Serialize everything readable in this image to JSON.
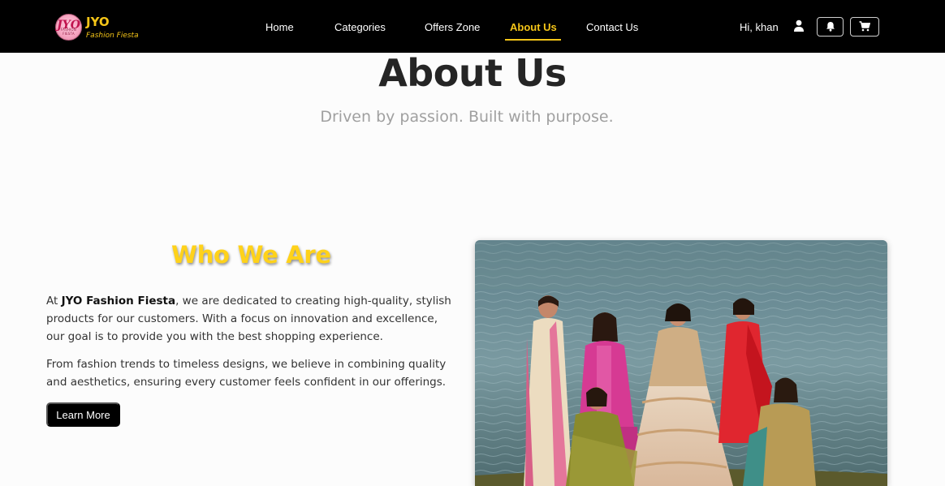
{
  "brand": {
    "logo_text": "JYO",
    "logo_subtext": "FASHION FIESTA",
    "name": "JYO",
    "tagline": "Fashion Fiesta"
  },
  "nav": {
    "links": [
      {
        "label": "Home",
        "active": false
      },
      {
        "label": "Categories",
        "active": false
      },
      {
        "label": "Offers Zone",
        "active": false
      },
      {
        "label": "About Us",
        "active": true
      },
      {
        "label": "Contact Us",
        "active": false
      }
    ],
    "greeting": "Hi, khan",
    "icons": [
      "user-icon",
      "bell-icon",
      "cart-icon"
    ]
  },
  "hero": {
    "title": "About Us",
    "subtitle": "Driven by passion. Built with purpose."
  },
  "who_we_are": {
    "heading": "Who We Are",
    "para1_prefix": "At ",
    "para1_brand": "JYO Fashion Fiesta",
    "para1_rest": ", we are dedicated to creating high-quality, stylish products for our customers. With a focus on innovation and excellence, our goal is to provide you with the best shopping experience.",
    "para2": "From fashion trends to timeless designs, we believe in combining quality and aesthetics, ensuring every customer feels confident in our offerings.",
    "button_label": "Learn More"
  },
  "colors": {
    "navbar_bg": "#000000",
    "accent": "#f5c518",
    "heading_yellow": "#ffd21a",
    "page_bg": "#fcfcfc"
  }
}
